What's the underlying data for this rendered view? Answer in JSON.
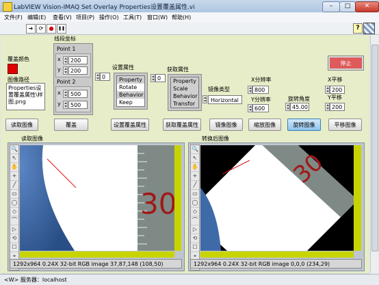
{
  "window": {
    "title": "LabVIEW Vision-IMAQ Set Overlay Properties设置覆盖属性.vi"
  },
  "menu": [
    "文件(F)",
    "编辑(E)",
    "查看(V)",
    "项目(P)",
    "操作(O)",
    "工具(T)",
    "窗口(W)",
    "帮助(H)"
  ],
  "toolbar": {
    "run": "➔",
    "run_continuous": "⟳",
    "abort": "●",
    "pause": "❚❚",
    "help": "?"
  },
  "controls": {
    "overlay_color_label": "覆盖颜色",
    "overlay_color": "#e00000",
    "image_path_label": "图像路径",
    "image_path_value": "Properties设置覆盖属性\\样图.png",
    "line_coords_label": "线段坐标",
    "point1_label": "Point 1",
    "point2_label": "Point 2",
    "point1_x": "200",
    "point1_y": "200",
    "point2_x": "500",
    "point2_y": "500",
    "x_label": "x",
    "y_label": "y",
    "set_props_label": "设置属性",
    "set_props_index": "0",
    "set_props_rows": [
      "Property",
      "Rotate",
      "Behavior",
      "Keep"
    ],
    "get_props_label": "获取属性",
    "get_props_index": "0",
    "get_props_rows": [
      "Property",
      "Scale",
      "Behavior",
      "Transfor"
    ],
    "mirror_type_label": "镜像类型",
    "mirror_type_value": "Horizontal",
    "x_res_label": "X分辨率",
    "x_res_value": "800",
    "y_res_label": "Y分辨率",
    "y_res_value": "600",
    "rotate_angle_label": "旋转角度",
    "rotate_angle_value": "45.00",
    "x_shift_label": "X平移",
    "x_shift_value": "200",
    "y_shift_label": "Y平移",
    "y_shift_value": "200",
    "stop_label": "停止"
  },
  "buttons": {
    "read_image": "读取图像",
    "overlay": "覆盖",
    "set_overlay_props": "设置覆盖属性",
    "get_overlay_props": "获取覆盖属性",
    "mirror_image": "镜像图像",
    "scale_image": "缩放图像",
    "rotate_image": "旋转图像",
    "shift_image": "平移图像"
  },
  "images": {
    "left_label": "读取图像",
    "right_label": "转换后图像",
    "left_info": "1292x964 0.24X 32-bit RGB image 37,87,148    (108,50)",
    "right_info": "1292x964 0.24X 32-bit RGB image 0,0,0    (234,29)",
    "ruler_text": "30"
  },
  "tools": [
    "🔍",
    "↖",
    "✋",
    "+",
    "╱",
    "▭",
    "◯",
    "◇",
    "⌒",
    "▷",
    "⟲",
    "☐",
    "⌖",
    "✎"
  ],
  "status": {
    "text": "<W> 服务器：localhost"
  }
}
